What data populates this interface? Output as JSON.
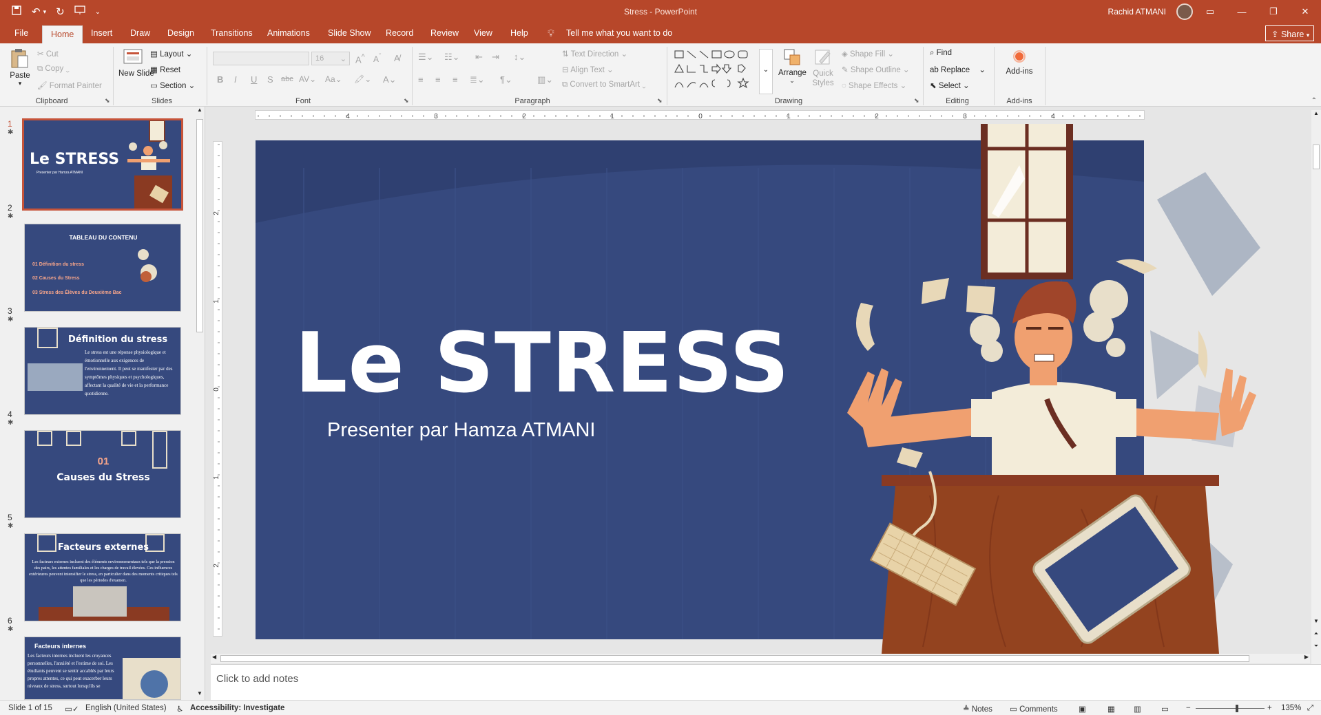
{
  "app": {
    "title": "Stress  -  PowerPoint",
    "user": "Rachid ATMANI"
  },
  "tabs": [
    "File",
    "Home",
    "Insert",
    "Draw",
    "Design",
    "Transitions",
    "Animations",
    "Slide Show",
    "Record",
    "Review",
    "View",
    "Help"
  ],
  "tell_me": "Tell me what you want to do",
  "share": "Share",
  "ribbon": {
    "clipboard": {
      "paste": "Paste",
      "cut": "Cut",
      "copy": "Copy",
      "format_painter": "Format Painter",
      "label": "Clipboard"
    },
    "slides": {
      "new_slide": "New Slide",
      "layout": "Layout",
      "reset": "Reset",
      "section": "Section",
      "label": "Slides"
    },
    "font": {
      "size": "16",
      "label": "Font"
    },
    "paragraph": {
      "text_direction": "Text Direction",
      "align_text": "Align Text",
      "smartart": "Convert to SmartArt",
      "label": "Paragraph"
    },
    "drawing": {
      "arrange": "Arrange",
      "quick_styles": "Quick Styles",
      "shape_fill": "Shape Fill",
      "shape_outline": "Shape Outline",
      "shape_effects": "Shape Effects",
      "label": "Drawing"
    },
    "editing": {
      "find": "Find",
      "replace": "Replace",
      "select": "Select",
      "label": "Editing"
    },
    "addins": {
      "addins": "Add-ins",
      "label": "Add-ins"
    }
  },
  "thumbnails": [
    {
      "num": "1",
      "title": "Le STRESS",
      "sub": "Presenter par Hamza ATMANI"
    },
    {
      "num": "2",
      "title": "TABLEAU DU CONTENU",
      "items": [
        "01  Définition du stress",
        "02  Causes du Stress",
        "03  Stress des Élèves du Deuxième Bac"
      ]
    },
    {
      "num": "3",
      "title": "Définition du stress",
      "body": "Le stress est une réponse physiologique et émotionnelle aux exigences de l'environnement. Il peut se manifester par des symptômes physiques et psychologiques, affectant la qualité de vie et la performance quotidienne."
    },
    {
      "num": "4",
      "title": "Causes du Stress",
      "kicker": "01"
    },
    {
      "num": "5",
      "title": "Facteurs externes",
      "body": "Les facteurs externes incluent des éléments environnementaux tels que la pression des pairs, les attentes familiales et les charges de travail élevées. Ces influences extérieures peuvent intensifier le stress, en particulier dans des moments critiques tels que les périodes d'examen."
    },
    {
      "num": "6",
      "title": "Facteurs internes",
      "body": "Les facteurs internes incluent les croyances personnelles, l'anxiété et l'estime de soi. Les étudiants peuvent se sentir accablés par leurs propres attentes, ce qui peut exacerber leurs niveaux de stress, surtout lorsqu'ils se"
    }
  ],
  "slide": {
    "title": "Le STRESS",
    "subtitle": "Presenter par Hamza ATMANI"
  },
  "ruler_h": [
    "4",
    "3",
    "2",
    "1",
    "0",
    "1",
    "2",
    "3",
    "4"
  ],
  "ruler_v": [
    "2",
    "1",
    "0",
    "1",
    "2"
  ],
  "notes_placeholder": "Click to add notes",
  "status": {
    "slide": "Slide 1 of 15",
    "language": "English (United States)",
    "accessibility": "Accessibility: Investigate",
    "notes": "Notes",
    "comments": "Comments",
    "zoom": "135%"
  },
  "colors": {
    "accent": "#b7472a",
    "slide_bg": "#36497e"
  }
}
